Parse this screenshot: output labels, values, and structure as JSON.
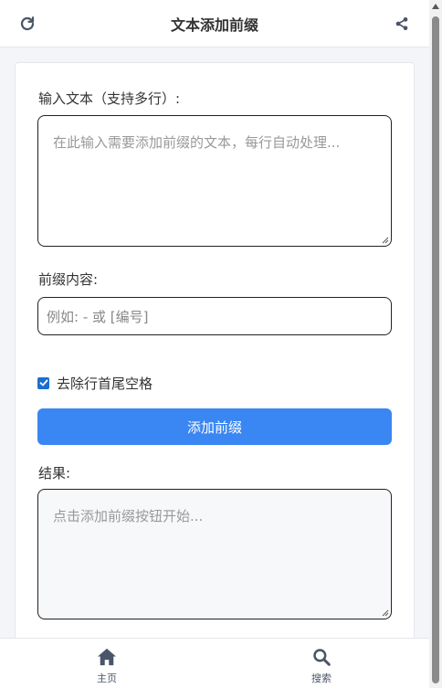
{
  "header": {
    "title": "文本添加前缀",
    "left_icon": "refresh-icon",
    "right_icon": "share-icon"
  },
  "form": {
    "input_label": "输入文本（支持多行）:",
    "input_placeholder": "在此输入需要添加前缀的文本，每行自动处理...",
    "prefix_label": "前缀内容:",
    "prefix_placeholder": "例如: - 或 [编号]",
    "trim_checked": true,
    "trim_label": "去除行首尾空格",
    "submit_label": "添加前缀",
    "result_label": "结果:",
    "result_placeholder": "点击添加前缀按钮开始..."
  },
  "nav": {
    "items": [
      {
        "label": "主页",
        "icon": "home-icon"
      },
      {
        "label": "搜索",
        "icon": "search-icon"
      }
    ]
  },
  "colors": {
    "accent": "#3a86f2",
    "checkbox": "#1a6fd1",
    "icon": "#4a5568"
  }
}
